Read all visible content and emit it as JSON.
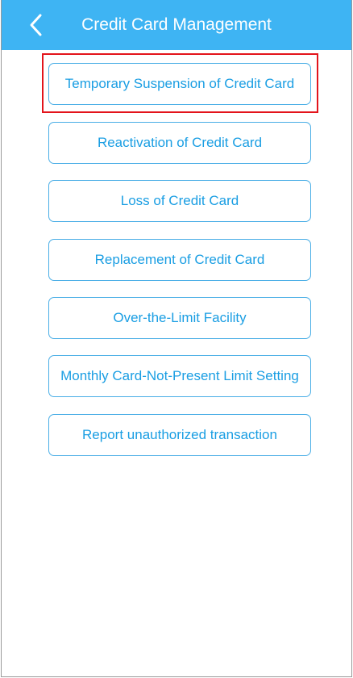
{
  "header": {
    "title": "Credit Card Management",
    "back_icon": "chevron-left-icon",
    "background_color": "#3eb4f3"
  },
  "menu": {
    "items": [
      {
        "label": "Temporary Suspension of Credit Card",
        "highlighted": true
      },
      {
        "label": "Reactivation of Credit Card"
      },
      {
        "label": "Loss of Credit Card"
      },
      {
        "label": "Replacement of Credit Card"
      },
      {
        "label": "Over-the-Limit Facility"
      },
      {
        "label": "Monthly Card-Not-Present Limit Setting"
      },
      {
        "label": "Report unauthorized transaction"
      }
    ]
  },
  "colors": {
    "accent": "#1a9ee3",
    "highlight_border": "#e3141b"
  }
}
